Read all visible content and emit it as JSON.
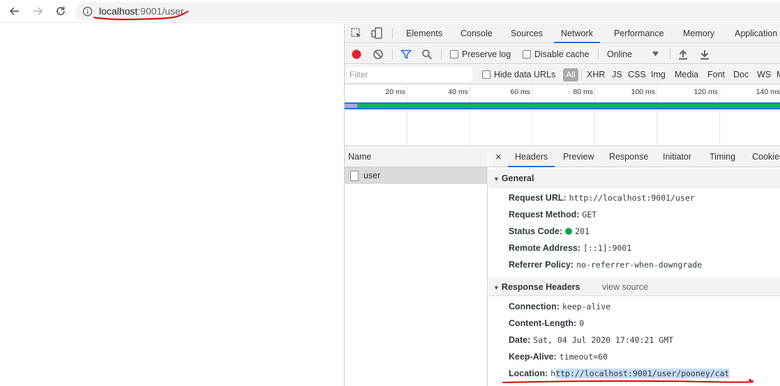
{
  "browser": {
    "url_host": "localhost",
    "url_rest": ":9001/user"
  },
  "devtools": {
    "tabs": [
      "Elements",
      "Console",
      "Sources",
      "Network",
      "Performance",
      "Memory",
      "Application"
    ],
    "active_tab": "Network",
    "toolbar": {
      "preserve_log": "Preserve log",
      "disable_cache": "Disable cache",
      "throttle": "Online"
    },
    "filter": {
      "placeholder": "Filter",
      "hide_data_urls": "Hide data URLs",
      "all": "All",
      "types": [
        "XHR",
        "JS",
        "CSS",
        "Img",
        "Media",
        "Font",
        "Doc",
        "WS",
        "M"
      ]
    },
    "timeline": {
      "ticks": [
        "20 ms",
        "40 ms",
        "60 ms",
        "80 ms",
        "100 ms",
        "120 ms",
        "140 ms"
      ]
    },
    "name_panel": {
      "header": "Name",
      "rows": [
        "user"
      ]
    },
    "detail": {
      "close": "×",
      "tabs": [
        "Headers",
        "Preview",
        "Response",
        "Initiator",
        "Timing",
        "Cookies"
      ],
      "general": {
        "title": "General",
        "rows": [
          {
            "key": "Request URL:",
            "value": "http://localhost:9001/user"
          },
          {
            "key": "Request Method:",
            "value": "GET"
          },
          {
            "key": "Status Code:",
            "value": "201"
          },
          {
            "key": "Remote Address:",
            "value": "[::1]:9001"
          },
          {
            "key": "Referrer Policy:",
            "value": "no-referrer-when-downgrade"
          }
        ]
      },
      "response_headers": {
        "title": "Response Headers",
        "view_source": "view source",
        "rows": [
          {
            "key": "Connection:",
            "value": "keep-alive"
          },
          {
            "key": "Content-Length:",
            "value": "0"
          },
          {
            "key": "Date:",
            "value": "Sat, 04 Jul 2020 17:40:21 GMT"
          },
          {
            "key": "Keep-Alive:",
            "value": "timeout=60"
          }
        ],
        "location_key": "Location:",
        "location_value_first": "h",
        "location_value_rest": "ttp://localhost:9001/user/pooney/cat"
      }
    }
  },
  "colors": {
    "accent": "#1a73e8",
    "record": "#e8202a",
    "status_ok": "#0aa74a",
    "annotation": "#e00000"
  }
}
